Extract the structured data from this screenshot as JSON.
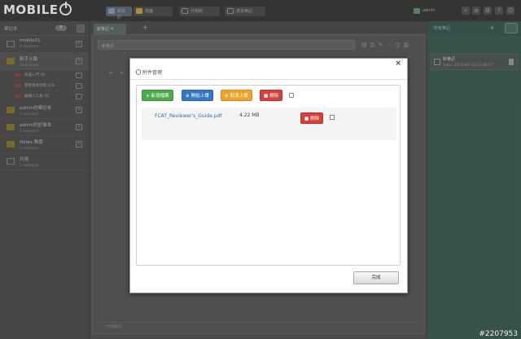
{
  "brand": {
    "logo": "MOBILE"
  },
  "topbar": {
    "buttons": [
      "新增記",
      "標籤",
      "分類館",
      "搜尋筆記"
    ],
    "user": "admin"
  },
  "sidebar": {
    "title": "筆記本",
    "badge": "8",
    "notebooks": [
      {
        "name": "mobile01",
        "sub": "1 sessions"
      },
      {
        "name": "新手上路",
        "sub": "3 sessions"
      },
      {
        "name": "admin的筆記本",
        "sub": "2 sessions"
      },
      {
        "name": "admin的記事本",
        "sub": "1 sessions"
      },
      {
        "name": "Notes 教學",
        "sub": "3 sessions"
      },
      {
        "name": "共用",
        "sub": "2 sessions"
      }
    ],
    "subitems": [
      {
        "name": "快速入門 (9)"
      },
      {
        "name": "使用基本功能 (21)"
      },
      {
        "name": "編輯小工具 (5)"
      }
    ]
  },
  "editor": {
    "tab": "新筆記",
    "title_placeholder": "新筆記",
    "footer": "附加檔案"
  },
  "rpanel": {
    "title": "所有筆記",
    "item_title": "新筆記",
    "item_date": "Date: 2014-03-14 03:46:57"
  },
  "modal": {
    "title": "附件管理",
    "close": "×",
    "buttons": {
      "add": "新增檔案",
      "upload": "開始上傳",
      "cancel": "取消上傳",
      "delete": "刪除"
    },
    "file": {
      "name": "FCAT_Reviewer's_Guide.pdf",
      "size": "4.22 MB",
      "delete": "刪除"
    },
    "done": "完成"
  },
  "watermark": "#2207953",
  "colors": {
    "green": "#4caa4c",
    "blue": "#3378c2",
    "orange": "#efa32a",
    "red": "#d2413b",
    "link": "#2a6fb0"
  }
}
